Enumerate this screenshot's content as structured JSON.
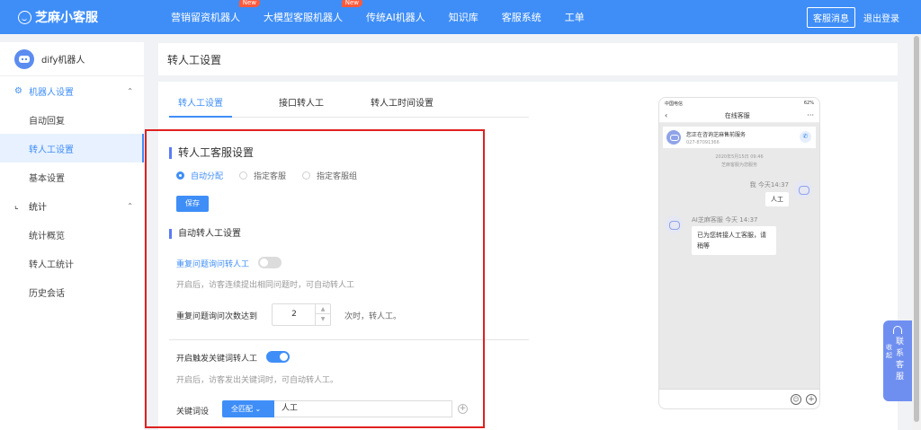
{
  "brand": {
    "name": "芝麻小客服"
  },
  "nav": {
    "items": [
      {
        "label": "营销留资机器人",
        "badge": "New"
      },
      {
        "label": "大模型客服机器人",
        "badge": "New"
      },
      {
        "label": "传统AI机器人",
        "badge": ""
      },
      {
        "label": "知识库",
        "badge": ""
      },
      {
        "label": "客服系统",
        "badge": ""
      },
      {
        "label": "工单",
        "badge": ""
      }
    ],
    "msg_button": "客服消息",
    "logout": "退出登录"
  },
  "sidebar": {
    "robot_name": "dify机器人",
    "groups": [
      {
        "label": "机器人设置",
        "icon": "gear-icon",
        "items": [
          "自动回复",
          "转人工设置",
          "基本设置"
        ]
      },
      {
        "label": "统计",
        "icon": "chart-icon",
        "items": [
          "统计概览",
          "转人工统计",
          "历史会话"
        ]
      }
    ],
    "selected": "转人工设置"
  },
  "page_title": "转人工设置",
  "tabs": [
    "转人工设置",
    "接口转人工",
    "转人工时间设置"
  ],
  "transfer": {
    "title": "转人工客服设置",
    "options": [
      "自动分配",
      "指定客服",
      "指定客服组"
    ],
    "selected_option": "自动分配",
    "save": "保存"
  },
  "auto": {
    "title": "自动转人工设置",
    "repeat_label": "重复问题询问转人工",
    "repeat_enabled": false,
    "repeat_hint": "开启后，访客连续提出相同问题时，可自动转人工",
    "count_label": "重复问题询问次数达到",
    "count_value": "2",
    "count_suffix": "次时，转人工。",
    "keyword_label": "开启触发关键词转人工",
    "keyword_enabled": true,
    "keyword_hint": "开启后，访客发出关键词时，可自动转人工。",
    "keyword_field_label": "关键词设",
    "match_mode": "全匹配",
    "keyword_value": "人工"
  },
  "preview": {
    "status_left": "中国电信",
    "status_right": "62%",
    "title": "在线客服",
    "banner_title": "您正在咨询芝麻售前服务",
    "banner_phone": "027-87091366",
    "time": "2020年5月15日 09:46",
    "time_note": "芝麻客服为您服务",
    "me_meta": "我 今天14:37",
    "me_text": "人工",
    "ai_meta": "AI芝麻客服 今天 14:37",
    "ai_text": "已为您转接人工客服，请稍等"
  },
  "contact": {
    "collapse": "收起",
    "label": "联系客服"
  }
}
